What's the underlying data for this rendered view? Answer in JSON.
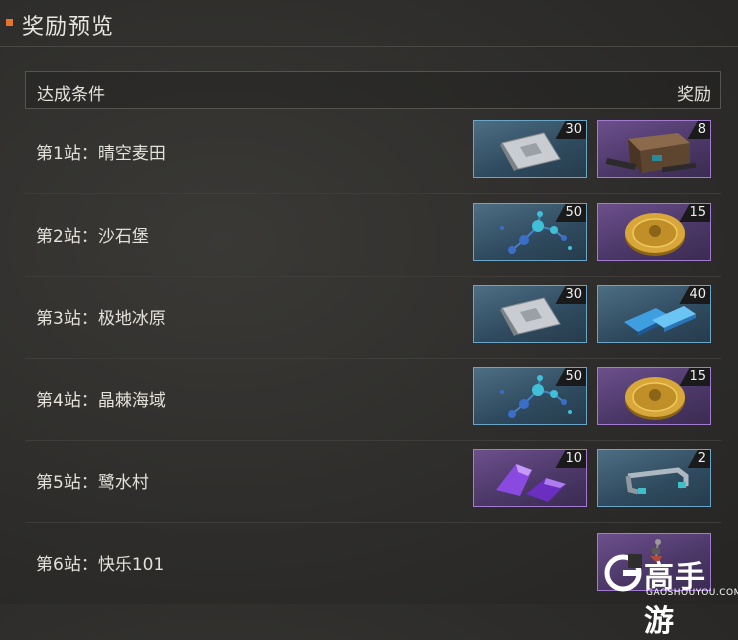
{
  "header": {
    "title": "奖励预览"
  },
  "table": {
    "condition_label": "达成条件",
    "reward_label": "奖励"
  },
  "rows": [
    {
      "label": "第1站：晴空麦田",
      "rewards": [
        {
          "icon": "supply-pack-icon",
          "rarity": "blue",
          "count": "30"
        },
        {
          "icon": "weapon-crate-icon",
          "rarity": "purple",
          "count": "8"
        }
      ]
    },
    {
      "label": "第2站：沙石堡",
      "rewards": [
        {
          "icon": "molecule-icon",
          "rarity": "blue",
          "count": "50"
        },
        {
          "icon": "gold-coin-icon",
          "rarity": "purple",
          "count": "15"
        }
      ]
    },
    {
      "label": "第3站：极地冰原",
      "rewards": [
        {
          "icon": "supply-pack-icon",
          "rarity": "blue",
          "count": "30"
        },
        {
          "icon": "blue-crystal-icon",
          "rarity": "blue",
          "count": "40"
        }
      ]
    },
    {
      "label": "第4站：晶棘海域",
      "rewards": [
        {
          "icon": "molecule-icon",
          "rarity": "blue",
          "count": "50"
        },
        {
          "icon": "gold-coin-icon",
          "rarity": "purple",
          "count": "15"
        }
      ]
    },
    {
      "label": "第5站：鹭水村",
      "rewards": [
        {
          "icon": "purple-crystal-icon",
          "rarity": "purple",
          "count": "10"
        },
        {
          "icon": "metal-clip-icon",
          "rarity": "blue",
          "count": "2"
        }
      ]
    },
    {
      "label": "第6站：快乐101",
      "rewards": [
        {
          "icon": "pendant-icon",
          "rarity": "purple",
          "count": ""
        }
      ]
    }
  ],
  "watermark": {
    "text": "高手游",
    "sub": "GAOSHOUYOU.COM"
  }
}
